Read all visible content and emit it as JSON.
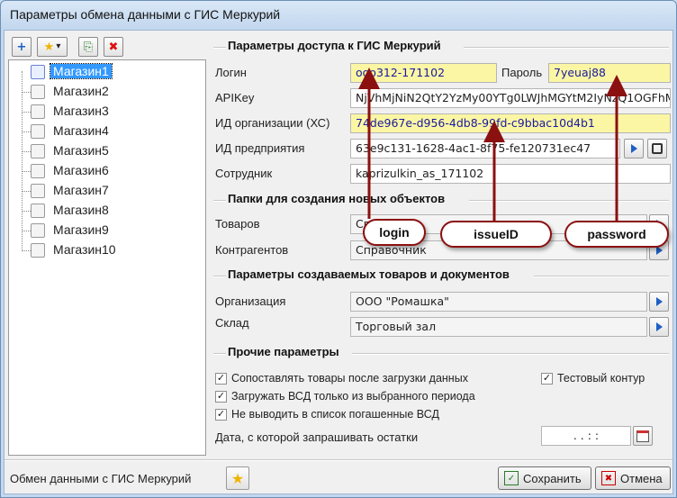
{
  "window": {
    "title": "Параметры обмена данными с ГИС Меркурий"
  },
  "toolbar": {
    "icons": [
      "add-icon",
      "star-icon",
      "dropdown-arrow-icon",
      "copy-icon",
      "delete-icon"
    ],
    "add_glyph": "+",
    "star_glyph": "★",
    "arrow_glyph": "▾",
    "copy_glyph": "⎘",
    "delete_glyph": "✖"
  },
  "tree": {
    "items": [
      {
        "label": "Магазин1",
        "selected": true
      },
      {
        "label": "Магазин2"
      },
      {
        "label": "Магазин3"
      },
      {
        "label": "Магазин4"
      },
      {
        "label": "Магазин5"
      },
      {
        "label": "Магазин6"
      },
      {
        "label": "Магазин7"
      },
      {
        "label": "Магазин8"
      },
      {
        "label": "Магазин9"
      },
      {
        "label": "Магазин10"
      }
    ]
  },
  "access": {
    "heading": "Параметры доступа к ГИС Меркурий",
    "login_label": "Логин",
    "login_value": "ooo312-171102",
    "password_label": "Пароль",
    "password_value": "7yeuaj88",
    "apikey_label": "APIKey",
    "apikey_value": "NjVhMjNiN2QtY2YzMy00YTg0LWJhMGYtM2IyNzQ1OGFhM",
    "org_label": "ИД организации (ХС)",
    "org_value": "74de967e-d956-4db8-99fd-c9bbac10d4b1",
    "enterprise_label": "ИД предприятия",
    "enterprise_value": "63e9c131-1628-4ac1-8f75-fe120731ec47",
    "employee_label": "Сотрудник",
    "employee_value": "kaprizulkin_as_171102"
  },
  "folders": {
    "heading": "Папки для создания новых объектов",
    "goods_label": "Товаров",
    "goods_value": "Сп",
    "partners_label": "Контрагентов",
    "partners_value": "Справочник"
  },
  "created": {
    "heading": "Параметры создаваемых товаров и документов",
    "org_label": "Организация",
    "org_value": "ООО \"Ромашка\"",
    "store_label": "Склад",
    "store_value": "Торговый зал"
  },
  "other": {
    "heading": "Прочие параметры",
    "chk1": "Сопоставлять товары после загрузки данных",
    "chk2": "Загружать ВСД только из выбранного периода",
    "chk3": "Не выводить в список погашенные ВСД",
    "chk_test": "Тестовый контур",
    "date_label": "Дата, с которой запрашивать остатки",
    "date_value": ".  .     :  :",
    "check_glyph": "✓"
  },
  "callouts": {
    "login": "login",
    "issue": "issueID",
    "password": "password"
  },
  "footer": {
    "caption": "Обмен данными с ГИС Меркурий",
    "save": "Сохранить",
    "cancel": "Отмена"
  },
  "colors": {
    "highlight_field": "#fbf6a4",
    "selection": "#3399ff",
    "arrow": "#8b1010",
    "link_blue": "#1e5fc4"
  }
}
